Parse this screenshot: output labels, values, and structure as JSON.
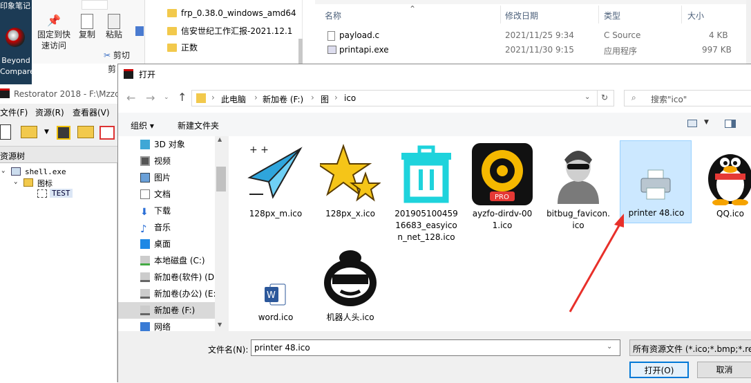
{
  "desktop": {
    "label_top": "印象笔记",
    "beyond_label": "Beyond Compare"
  },
  "ribbon": {
    "pin_label": "固定到快速访问",
    "copy_label": "复制",
    "paste_label": "粘贴",
    "cut_label": "剪切",
    "clip_label": "剪"
  },
  "explorer_nav": [
    "frp_0.38.0_windows_amd64",
    "信安世纪工作汇报-2021.12.1",
    "正数"
  ],
  "explorer_list": {
    "headers": [
      "名称",
      "修改日期",
      "类型",
      "大小"
    ],
    "rows": [
      {
        "name": "payload.c",
        "date": "2021/11/25 9:34",
        "type": "C Source",
        "size": "4 KB"
      },
      {
        "name": "printapi.exe",
        "date": "2021/11/30 9:15",
        "type": "应用程序",
        "size": "997 KB"
      }
    ]
  },
  "restorator": {
    "title": "Restorator 2018 - F:\\Mzzc",
    "menu": [
      "文件(F)",
      "资源(R)",
      "查看器(V)"
    ],
    "tree_header": "资源树",
    "tree": [
      "shell.exe",
      "图标",
      "TEST"
    ]
  },
  "dialog": {
    "title": "打开",
    "breadcrumb": [
      "此电脑",
      "新加卷 (F:)",
      "图",
      "ico"
    ],
    "search_placeholder": "搜索\"ico\"",
    "organize": "组织 ▾",
    "new_folder": "新建文件夹",
    "nav": [
      "3D 对象",
      "视频",
      "图片",
      "文档",
      "下载",
      "音乐",
      "桌面",
      "本地磁盘 (C:)",
      "新加卷(软件) (D:",
      "新加卷(办公) (E:",
      "新加卷 (F:)",
      "网络"
    ],
    "files": [
      {
        "name": "128px_m.ico",
        "icon": "paper-plane"
      },
      {
        "name": "128px_x.ico",
        "icon": "stars"
      },
      {
        "name": "20190510045916683_easyicon_net_128.ico",
        "icon": "trash-can"
      },
      {
        "name": "ayzfo-dirdv-001.ico",
        "icon": "pro-dial"
      },
      {
        "name": "bitbug_favicon.ico",
        "icon": "hacker"
      },
      {
        "name": "printer 48.ico",
        "icon": "printer"
      },
      {
        "name": "QQ.ico",
        "icon": "penguin"
      },
      {
        "name": "word.ico",
        "icon": "word"
      },
      {
        "name": "机器人头.ico",
        "icon": "robot-head"
      }
    ],
    "filename_label": "文件名(N):",
    "filename_value": "printer 48.ico",
    "filter_value": "所有资源文件 (*.ico;*.bmp;*.re",
    "open_button": "打开(O)",
    "cancel_button": "取消"
  },
  "colors": {
    "selection": "#cce8ff",
    "selection_border": "#99d1ff",
    "arrow": "#e8302a",
    "accent": "#0078d7"
  }
}
